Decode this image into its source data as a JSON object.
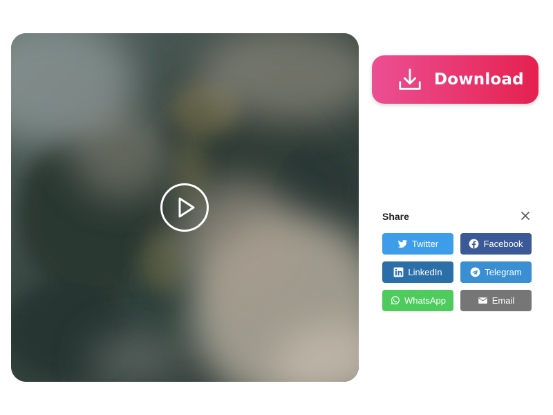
{
  "media": {
    "play_icon": "play-icon"
  },
  "download": {
    "label": "Download",
    "icon": "download-icon",
    "gradient": [
      "#ec4f93",
      "#e5214f"
    ]
  },
  "share": {
    "title": "Share",
    "close_icon": "close-icon",
    "buttons": [
      {
        "label": "Twitter",
        "icon": "twitter-icon",
        "color": "#3d9de9"
      },
      {
        "label": "Facebook",
        "icon": "facebook-icon",
        "color": "#3b5997"
      },
      {
        "label": "LinkedIn",
        "icon": "linkedin-icon",
        "color": "#2b6fa8"
      },
      {
        "label": "Telegram",
        "icon": "telegram-icon",
        "color": "#3a8fd3"
      },
      {
        "label": "WhatsApp",
        "icon": "whatsapp-icon",
        "color": "#4dcb5c"
      },
      {
        "label": "Email",
        "icon": "email-icon",
        "color": "#767676"
      }
    ]
  }
}
